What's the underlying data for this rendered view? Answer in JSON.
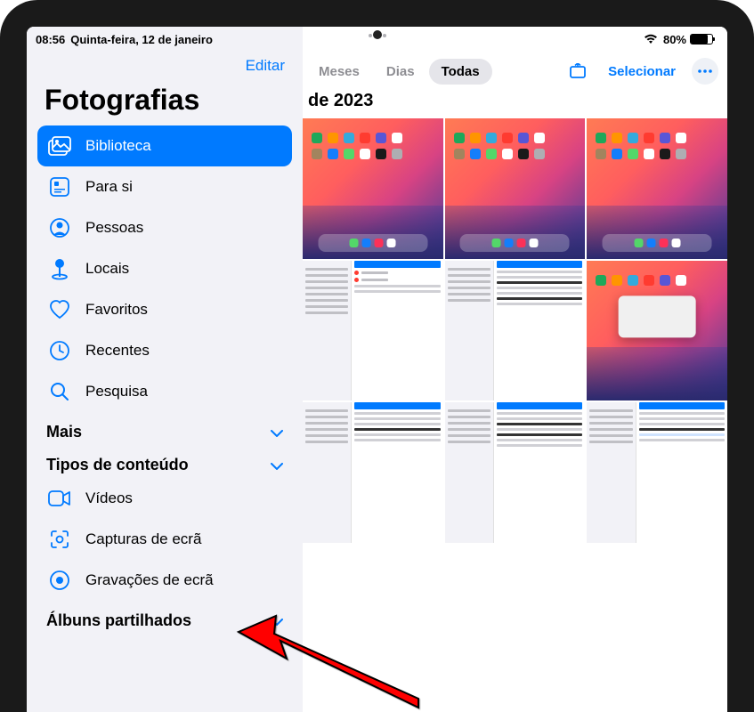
{
  "status": {
    "time": "08:56",
    "date": "Quinta-feira, 12 de janeiro",
    "battery_pct": "80%",
    "battery_level": 80
  },
  "sidebar": {
    "edit": "Editar",
    "title": "Fotografias",
    "items": [
      {
        "key": "library",
        "label": "Biblioteca",
        "selected": true
      },
      {
        "key": "foryou",
        "label": "Para si"
      },
      {
        "key": "people",
        "label": "Pessoas"
      },
      {
        "key": "places",
        "label": "Locais"
      },
      {
        "key": "favorites",
        "label": "Favoritos"
      },
      {
        "key": "recents",
        "label": "Recentes"
      },
      {
        "key": "search",
        "label": "Pesquisa"
      }
    ],
    "sections": {
      "more": "Mais",
      "content_types": "Tipos de conteúdo",
      "shared_albums": "Álbuns partilhados"
    },
    "content_type_items": [
      {
        "key": "videos",
        "label": "Vídeos"
      },
      {
        "key": "screenshots",
        "label": "Capturas de ecrã"
      },
      {
        "key": "screenrec",
        "label": "Gravações de ecrã"
      }
    ]
  },
  "main": {
    "tabs": [
      {
        "key": "months",
        "label": "Meses"
      },
      {
        "key": "days",
        "label": "Dias"
      },
      {
        "key": "all",
        "label": "Todas",
        "active": true
      }
    ],
    "select": "Selecionar",
    "year_heading": "de 2023"
  }
}
